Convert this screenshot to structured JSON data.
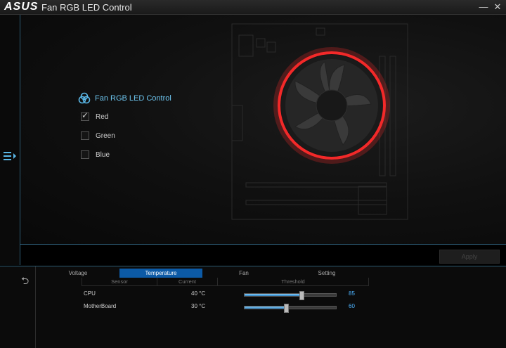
{
  "window": {
    "logo": "ASUS",
    "title": "Fan RGB LED Control",
    "minimize_glyph": "—",
    "close_glyph": "✕"
  },
  "panel": {
    "title": "Fan RGB LED Control",
    "options": [
      {
        "label": "Red",
        "checked": true
      },
      {
        "label": "Green",
        "checked": false
      },
      {
        "label": "Blue",
        "checked": false
      }
    ]
  },
  "apply_label": "Apply",
  "tabs": [
    "Voltage",
    "Temperature",
    "Fan",
    "Setting"
  ],
  "active_tab": "Temperature",
  "columns": [
    "Sensor",
    "Current",
    "Threshold"
  ],
  "rows": [
    {
      "sensor": "CPU",
      "current": "40 °C",
      "threshold": "85",
      "threshold_fraction": 0.62
    },
    {
      "sensor": "MotherBoard",
      "current": "30 °C",
      "threshold": "60",
      "threshold_fraction": 0.45
    }
  ],
  "colors": {
    "accent": "#0c5aa6",
    "value": "#4db3ff",
    "led": "#ff2a2a"
  },
  "icons": {
    "menu": "menu-expand-icon",
    "back": "back-arrow-icon",
    "rgb": "rgb-circles-icon"
  }
}
